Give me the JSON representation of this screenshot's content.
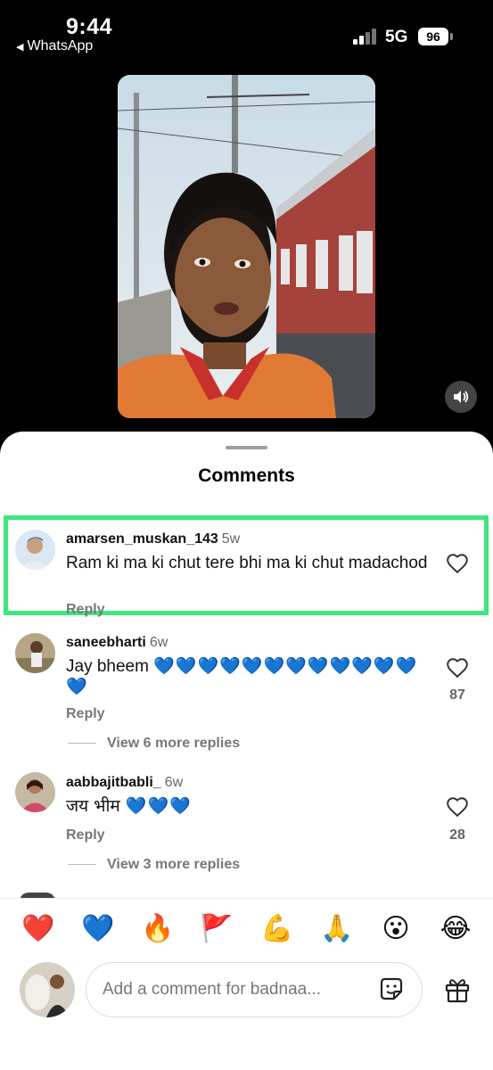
{
  "status_bar": {
    "time": "9:44",
    "back_app": "WhatsApp",
    "network": "5G",
    "battery": "96"
  },
  "sheet": {
    "title": "Comments"
  },
  "comments": [
    {
      "username": "amarsen_muskan_143",
      "age": "5w",
      "text": "Ram ki ma ki chut tere bhi ma ki chut madachod",
      "reply_label": "Reply",
      "highlighted": true
    },
    {
      "username": "saneebharti",
      "age": "6w",
      "text": "Jay bheem ",
      "hearts": "💙💙💙💙💙💙💙💙💙💙💙💙💙",
      "reply_label": "Reply",
      "likes": "87",
      "more_replies": "View 6 more replies"
    },
    {
      "username": "aabbajitbabli_",
      "age": "6w",
      "text": "जय भीम ",
      "hearts": "💙💙💙",
      "reply_label": "Reply",
      "likes": "28",
      "more_replies": "View 3 more replies"
    }
  ],
  "emoji_bar": [
    "❤️",
    "💙",
    "🔥",
    "🚩",
    "💪",
    "🙏",
    "😮",
    "😂"
  ],
  "composer": {
    "placeholder": "Add a comment for badnaa..."
  },
  "colors": {
    "highlight": "#3ee67e",
    "heart_blue": "#1a6cf0",
    "sheet": "#ffffff"
  },
  "icons": [
    "volume-icon",
    "heart-outline-icon",
    "sticker-icon",
    "gift-icon",
    "back-arrow-icon",
    "signal-icon"
  ]
}
